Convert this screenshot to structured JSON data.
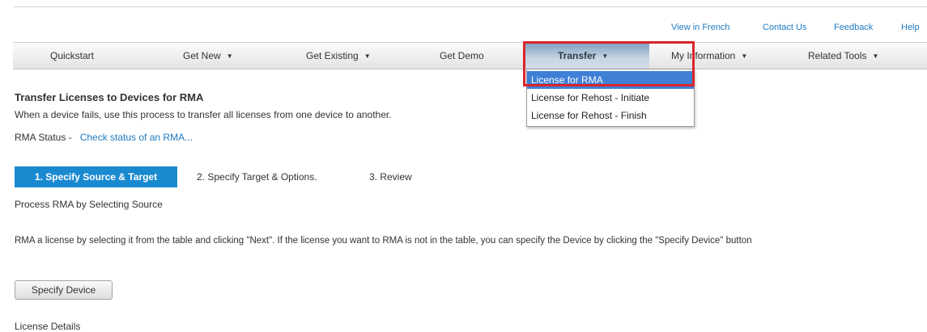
{
  "utility_links": [
    {
      "label": "View in French"
    },
    {
      "label": "Contact Us"
    },
    {
      "label": "Feedback"
    },
    {
      "label": "Help"
    }
  ],
  "nav": {
    "items": [
      {
        "label": "Quickstart",
        "caret": ""
      },
      {
        "label": "Get New",
        "caret": "▼"
      },
      {
        "label": "Get Existing",
        "caret": "▼"
      },
      {
        "label": "Get Demo",
        "caret": ""
      },
      {
        "label": "Transfer",
        "caret": "▼"
      },
      {
        "label": "My Information",
        "caret": "▼"
      },
      {
        "label": "Related Tools",
        "caret": "▼"
      }
    ],
    "active": "Transfer",
    "active_gradient": [
      "#7f9fc0",
      "#d3dde7"
    ]
  },
  "transfer_menu": {
    "items": [
      {
        "label": "License for RMA",
        "selected": true
      },
      {
        "label": "License for Rehost - Initiate",
        "selected": false
      },
      {
        "label": "License for Rehost - Finish",
        "selected": false
      }
    ],
    "selected_color": "#3f7fd6",
    "highlight_color": "#d9252a"
  },
  "page": {
    "title": "Transfer Licenses to Devices for RMA",
    "description": "When a device fails, use this process to transfer all licenses from one device to another.",
    "rma_status_label": "RMA Status -",
    "rma_status_link": "Check status of an RMA..."
  },
  "steps": [
    {
      "label": "1. Specify Source & Target",
      "active": true
    },
    {
      "label": "2. Specify Target & Options.",
      "active": false
    },
    {
      "label": "3. Review",
      "active": false
    }
  ],
  "step_active_color": "#1a8ad0",
  "process_label": "Process RMA by Selecting Source",
  "instructions": "RMA a license by selecting it from the table and clicking \"Next\". If the license you want to RMA is not in the table, you can specify the Device by clicking the \"Specify Device\" button",
  "specify_device_button": "Specify Device",
  "license_details_label": "License Details",
  "link_color": "#1f7bc1"
}
